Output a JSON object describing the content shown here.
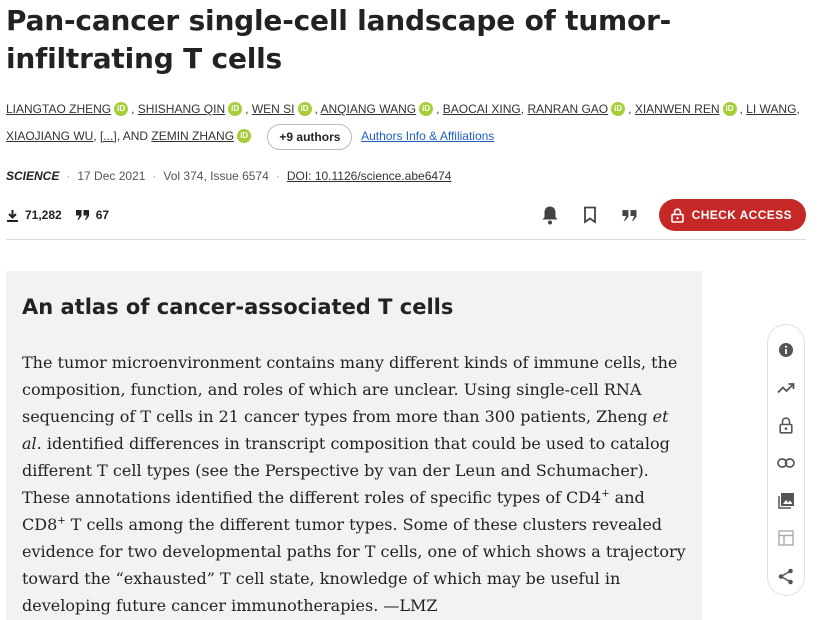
{
  "article": {
    "title": "Pan-cancer single-cell landscape of tumor-infiltrating T cells"
  },
  "authors": {
    "line1": [
      {
        "name": "Liangtao Zheng",
        "orcid": true
      },
      {
        "name": "Shishang Qin",
        "orcid": true
      },
      {
        "name": "Wen Si",
        "orcid": true
      },
      {
        "name": "Anqiang Wang",
        "orcid": true
      },
      {
        "name": "Baocai Xing",
        "orcid": false
      },
      {
        "name": "Ranran Gao",
        "orcid": true
      },
      {
        "name": "Xianwen Ren",
        "orcid": true
      },
      {
        "name": "Li Wang",
        "orcid": false
      }
    ],
    "line2_first": "Xiaojiang Wu",
    "ellipsis": "[...]",
    "and_text": "AND",
    "last_author": "Zemin Zhang",
    "orcid_label": "iD",
    "more_button": "+9 authors",
    "affiliations_link": "Authors Info & Affiliations"
  },
  "meta": {
    "journal": "SCIENCE",
    "date": "17 Dec 2021",
    "volume": "Vol 374, Issue 6574",
    "doi": "DOI: 10.1126/science.abe6474"
  },
  "metrics": {
    "downloads": "71,282",
    "citations": "67"
  },
  "actions": {
    "check_access": "CHECK ACCESS"
  },
  "abstract": {
    "title": "An atlas of cancer-associated T cells",
    "p1": "The tumor microenvironment contains many different kinds of immune cells, the composition, function, and roles of which are unclear. Using single-cell RNA sequencing of T cells in 21 cancer types from more than 300 patients, Zheng ",
    "et_al": "et al",
    "p2": ". identified differences in transcript composition that could be used to catalog different T cell types (see the Perspective by van der Leun and Schumacher). These annotations identified the different roles of specific types of CD4",
    "sup1": "+",
    "p3": " and CD8",
    "sup2": "+",
    "p4": " T cells among the different tumor types. Some of these clusters revealed evidence for two developmental paths for T cells, one of which shows a trajectory toward the “exhausted” T cell state, knowledge of which may be useful in developing future cancer immunotherapies. —LMZ"
  },
  "side_toolbar": [
    "info-icon",
    "trending-icon",
    "unlock-icon",
    "link-icon",
    "image-icon",
    "table-icon",
    "share-icon"
  ],
  "colors": {
    "accent_red": "#c62828",
    "orcid_green": "#a6ce39",
    "link_blue": "#1f5fbf",
    "abstract_bg": "#f2f2f2"
  }
}
